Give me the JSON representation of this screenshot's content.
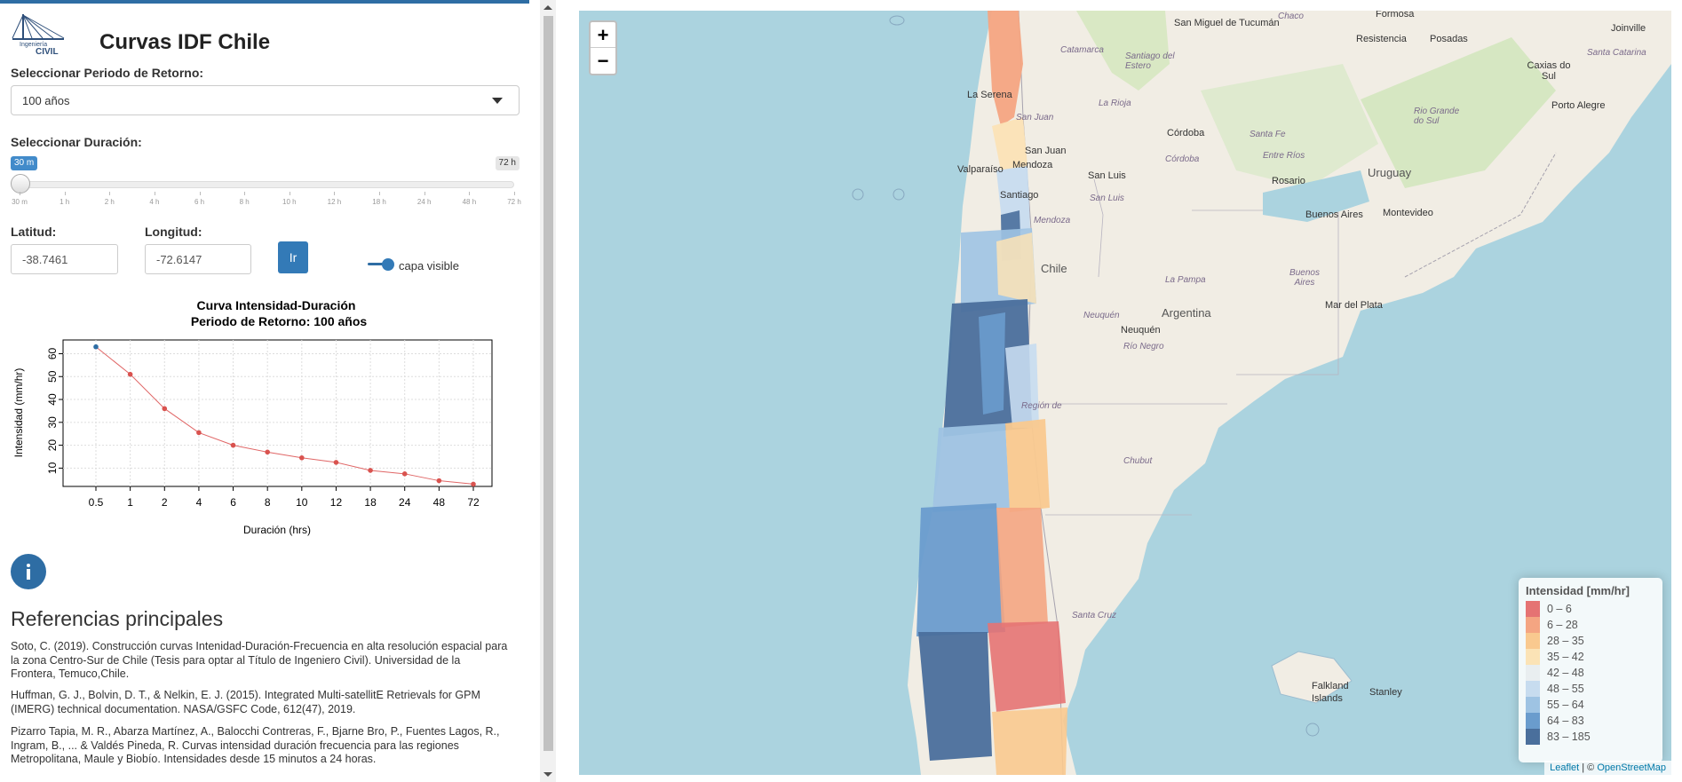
{
  "header": {
    "title": "Curvas IDF Chile",
    "logo_text": "Ingeniería CIVIL"
  },
  "return_period": {
    "label": "Seleccionar Periodo de Retorno:",
    "selected": "100 años"
  },
  "duration": {
    "label": "Seleccionar Duración:",
    "value_label": "30 m",
    "max_label": "72 h",
    "ticks": [
      "30 m",
      "1 h",
      "2 h",
      "4 h",
      "6 h",
      "8 h",
      "10 h",
      "12 h",
      "18 h",
      "24 h",
      "48 h",
      "72 h"
    ]
  },
  "coords": {
    "lat_label": "Latitud:",
    "lat_value": "-38.7461",
    "lon_label": "Longitud:",
    "lon_value": "-72.6147",
    "go_label": "Ir",
    "layer_toggle_label": "capa visible"
  },
  "chart_data": {
    "type": "line",
    "title": "Curva Intensidad-Duración",
    "subtitle": "Periodo de Retorno: 100 años",
    "xlabel": "Duración (hrs)",
    "ylabel": "Intensidad (mm/hr)",
    "categories": [
      "0.5",
      "1",
      "2",
      "4",
      "6",
      "8",
      "10",
      "12",
      "18",
      "24",
      "48",
      "72"
    ],
    "values": [
      63,
      51,
      36,
      25.5,
      20,
      17,
      14.5,
      12.5,
      9,
      7.5,
      4.5,
      3
    ],
    "yticks": [
      10,
      20,
      30,
      40,
      50,
      60
    ],
    "ylim": [
      2,
      66
    ],
    "grid": true,
    "colors": {
      "line": "#e06666",
      "first_point": "#2e6da4",
      "points": "#d9534f"
    }
  },
  "references": {
    "title": "Referencias principales",
    "items": [
      "Soto, C. (2019). Construcción curvas Intenidad-Duración-Frecuencia en alta resolución espacial para la zona Centro-Sur de Chile (Tesis para optar al Título de Ingeniero Civil). Universidad de la Frontera, Temuco,Chile.",
      "Huffman, G. J., Bolvin, D. T., & Nelkin, E. J. (2015). Integrated Multi-satellitE Retrievals for GPM (IMERG) technical documentation. NASA/GSFC Code, 612(47), 2019.",
      "Pizarro Tapia, M. R., Abarza Martínez, A., Balocchi Contreras, F., Bjarne Bro, P., Fuentes Lagos, R., Ingram, B., ... & Valdés Pineda, R. Curvas intensidad duración frecuencia para las regiones Metropolitana, Maule y Biobío. Intensidades desde 15 minutos a 24 horas."
    ]
  },
  "map": {
    "zoom_in": "+",
    "zoom_out": "−",
    "labels": {
      "tucuman": "San Miguel de Tucumán",
      "formosa": "Formosa",
      "chaco": "Chaco",
      "resistencia": "Resistencia",
      "posadas": "Posadas",
      "joinville": "Joinville",
      "santa_catarina": "Santa Catarina",
      "caxias": "Caxias do Sul",
      "porto_alegre": "Porto Alegre",
      "rio_grande": "Rio Grande do Sul",
      "catamarca": "Catamarca",
      "santiago_estero": "Santiago del Estero",
      "la_serena": "La Serena",
      "la_rioja": "La Rioja",
      "cordoba_city": "Córdoba",
      "santa_fe": "Santa Fe",
      "san_juan_region": "San Juan",
      "san_juan": "San Juan",
      "cordoba_region": "Córdoba",
      "entre_rios": "Entre Ríos",
      "uruguay": "Uruguay",
      "valparaiso": "Valparaíso",
      "mendoza_city": "Mendoza",
      "san_luis": "San Luis",
      "san_luis_region": "San Luis",
      "rosario": "Rosario",
      "santiago": "Santiago",
      "buenos_aires_city": "Buenos Aires",
      "montevideo": "Montevideo",
      "mendoza_region": "Mendoza",
      "chile": "Chile",
      "la_pampa": "La Pampa",
      "buenos_aires_region": "Buenos Aires",
      "argentina": "Argentina",
      "mar_del_plata": "Mar del Plata",
      "neuquen_region": "Neuquén",
      "neuquen": "Neuquén",
      "rio_negro": "Río Negro",
      "chubut": "Chubut",
      "santa_cruz": "Santa Cruz",
      "falkland": "Falkland Islands",
      "stanley": "Stanley",
      "region_de": "Región de"
    },
    "legend": {
      "title": "Intensidad [mm/hr]",
      "items": [
        {
          "label": "0 – 6",
          "color": "#e57373"
        },
        {
          "label": "6 – 28",
          "color": "#f4a582"
        },
        {
          "label": "28 – 35",
          "color": "#f9c98f"
        },
        {
          "label": "35 – 42",
          "color": "#fbe3b6"
        },
        {
          "label": "42 – 48",
          "color": "#e9eef0"
        },
        {
          "label": "48 – 55",
          "color": "#c7dcef"
        },
        {
          "label": "55 – 64",
          "color": "#9ec3e3"
        },
        {
          "label": "64 – 83",
          "color": "#6a9ccd"
        },
        {
          "label": "83 – 185",
          "color": "#4a6f9c"
        }
      ]
    },
    "attribution": {
      "leaflet": "Leaflet",
      "separator": " | © ",
      "osm": "OpenStreetMap"
    }
  }
}
